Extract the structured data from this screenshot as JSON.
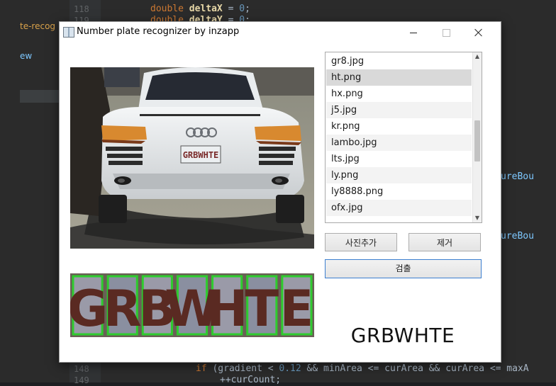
{
  "ide": {
    "line_118": {
      "num": "118",
      "kw": "double",
      "id": "deltaX",
      "op": " = ",
      "val": "0",
      "end": ";"
    },
    "line_119": {
      "num": "119",
      "kw": "double",
      "id": "deltaY",
      "op": " = ",
      "val": "0",
      "end": ";"
    },
    "line_148": {
      "num": "148",
      "kw": "if",
      "p1": " (gradient < ",
      "val": "0.12",
      "p2": " && minArea <= curArea && curArea <= maxA"
    },
    "line_149": {
      "num": "149",
      "text": "++curCount;"
    },
    "left_labels": [
      "te-recog",
      "ew"
    ],
    "right_labels": [
      "ureBou",
      "ureBou"
    ]
  },
  "window": {
    "title": "Number plate recognizer by inzapp",
    "icon": "app-window-icon"
  },
  "file_list": {
    "items": [
      "gr8.jpg",
      "ht.png",
      "hx.png",
      "j5.jpg",
      "kr.png",
      "lambo.jpg",
      "lts.jpg",
      "ly.png",
      "ly8888.png",
      "ofx.jpg"
    ],
    "selected": "ht.png"
  },
  "buttons": {
    "add_photo": "사진추가",
    "remove": "제거",
    "detect": "검출"
  },
  "result_text": "GRBWHTE",
  "photo": {
    "plate_text": "GRBWHTE",
    "segmented_chars": [
      "G",
      "R",
      "B",
      "W",
      "H",
      "T",
      "E"
    ]
  }
}
